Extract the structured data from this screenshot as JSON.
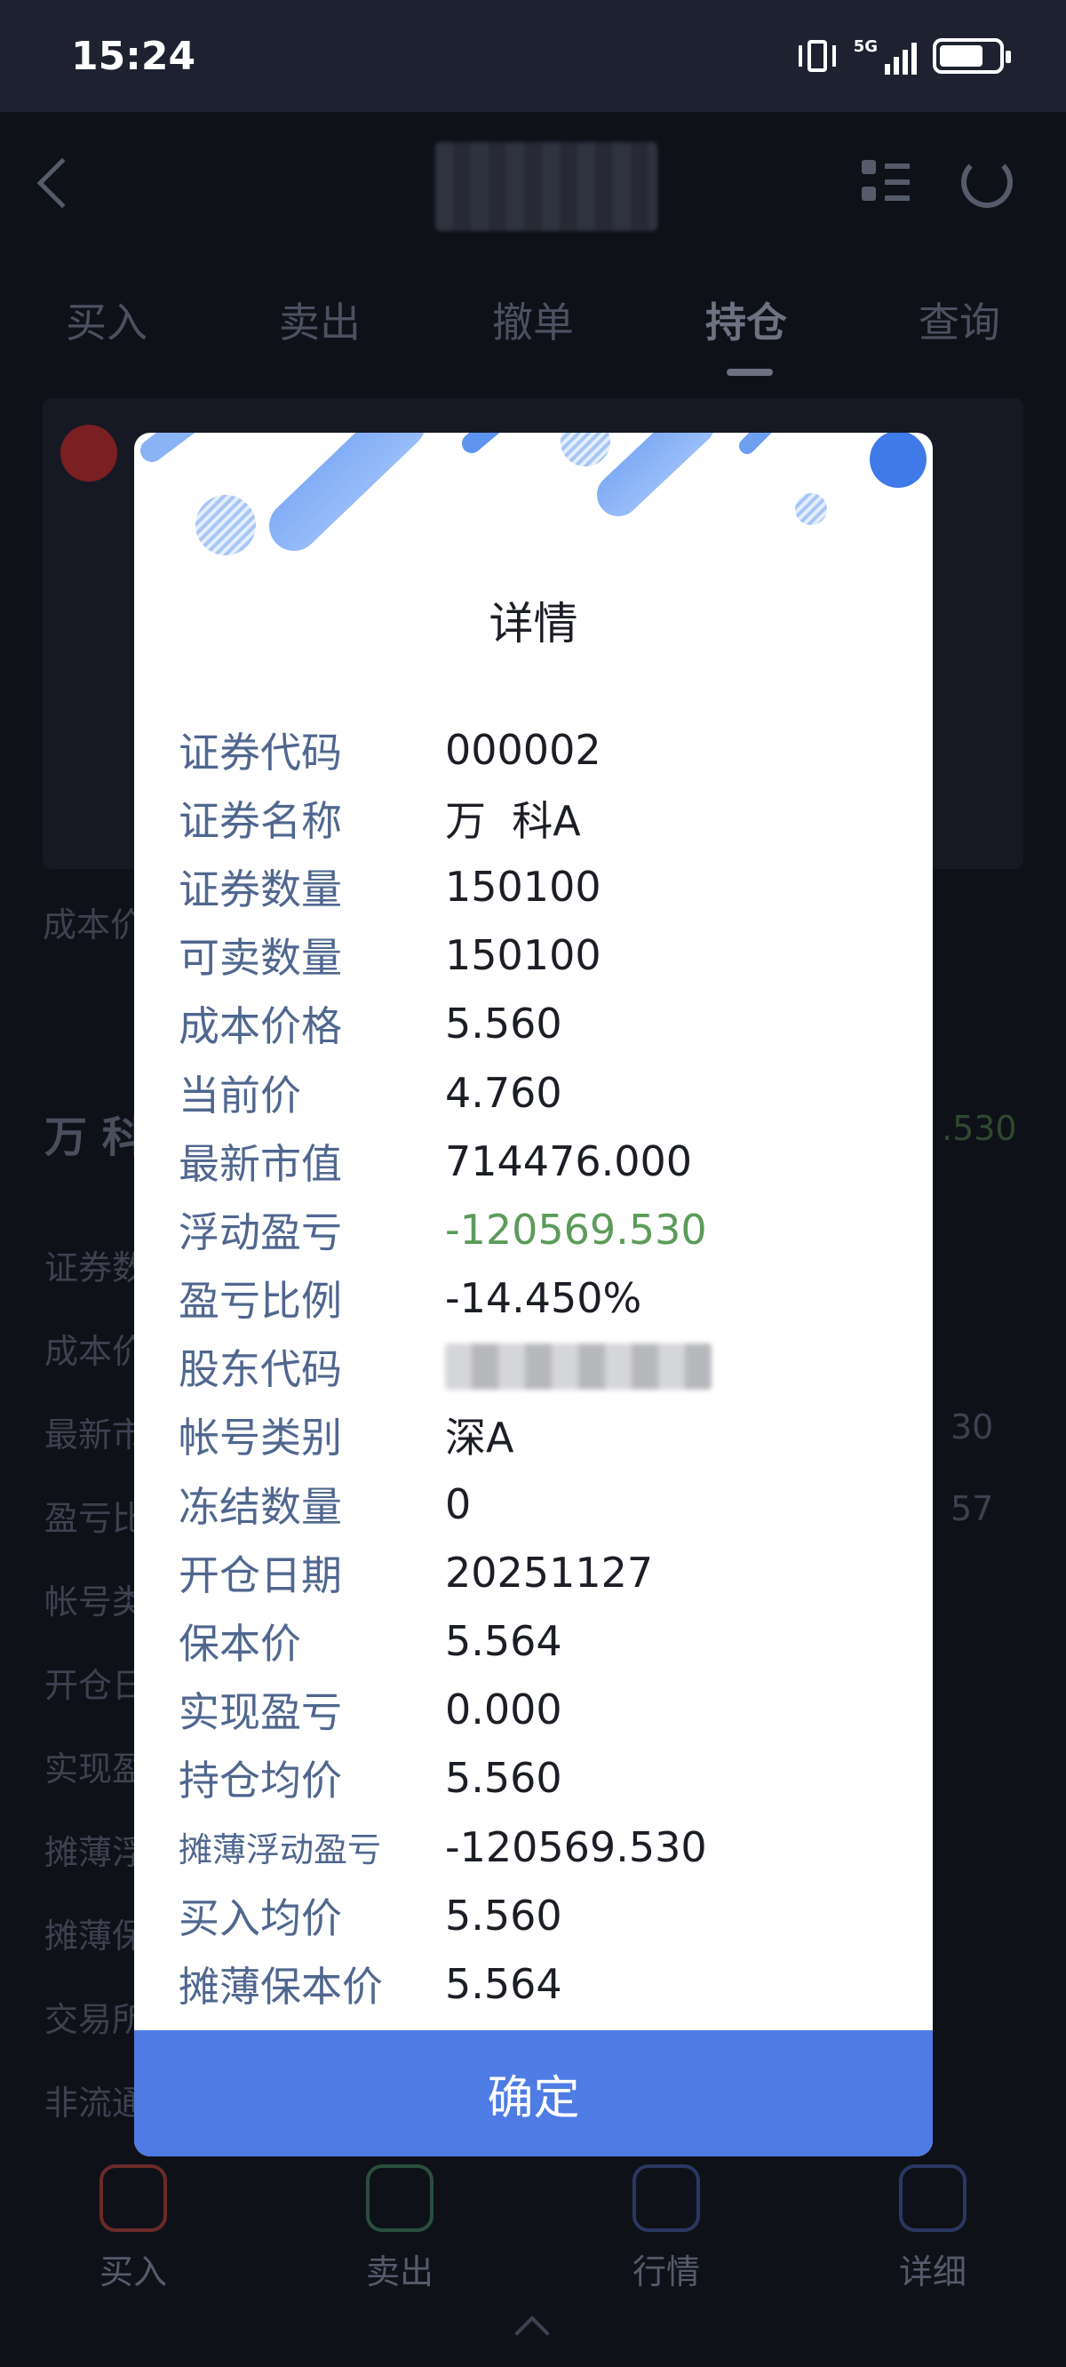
{
  "status_bar": {
    "time": "15:24",
    "network": "5G"
  },
  "header": {
    "tabs": [
      {
        "label": "买入"
      },
      {
        "label": "卖出"
      },
      {
        "label": "撤单"
      },
      {
        "label": "持仓",
        "active": true
      },
      {
        "label": "查询"
      }
    ]
  },
  "background_peek": {
    "cost_label": "成本价",
    "stock_name_fragment": "万 科",
    "right_value_1": ".530",
    "row_labels": [
      "证券数",
      "成本价",
      "最新市",
      "盈亏比",
      "帐号类",
      "开仓日",
      "实现盈",
      "摊薄浮",
      "摊薄保",
      "交易所",
      "非流通"
    ],
    "right_values": [
      "30",
      "57"
    ]
  },
  "bottom_nav": [
    {
      "label": "买入",
      "icon": "download-icon",
      "color": "#7a2e2e"
    },
    {
      "label": "卖出",
      "icon": "upload-icon",
      "color": "#2e5a44"
    },
    {
      "label": "行情",
      "icon": "chart-icon",
      "color": "#2e3f6e"
    },
    {
      "label": "详细",
      "icon": "document-icon",
      "color": "#2e3f6e"
    }
  ],
  "dialog": {
    "title": "详情",
    "confirm_label": "确定",
    "fields": [
      {
        "label": "证券代码",
        "value": "000002"
      },
      {
        "label": "证券名称",
        "value": "万  科A"
      },
      {
        "label": "证券数量",
        "value": "150100"
      },
      {
        "label": "可卖数量",
        "value": "150100"
      },
      {
        "label": "成本价格",
        "value": "5.560"
      },
      {
        "label": "当前价",
        "value": "4.760"
      },
      {
        "label": "最新市值",
        "value": "714476.000"
      },
      {
        "label": "浮动盈亏",
        "value": "-120569.530",
        "color": "#5c9b5a"
      },
      {
        "label": "盈亏比例",
        "value": "-14.450%"
      },
      {
        "label": "股东代码",
        "value": ""
      },
      {
        "label": "帐号类别",
        "value": "深A"
      },
      {
        "label": "冻结数量",
        "value": "0"
      },
      {
        "label": "开仓日期",
        "value": "20251127"
      },
      {
        "label": "保本价",
        "value": "5.564"
      },
      {
        "label": "实现盈亏",
        "value": "0.000"
      },
      {
        "label": "持仓均价",
        "value": "5.560"
      },
      {
        "label": "摊薄浮动盈亏",
        "value": "-120569.530"
      },
      {
        "label": "买入均价",
        "value": "5.560"
      },
      {
        "label": "摊薄保本价",
        "value": "5.564"
      }
    ]
  }
}
